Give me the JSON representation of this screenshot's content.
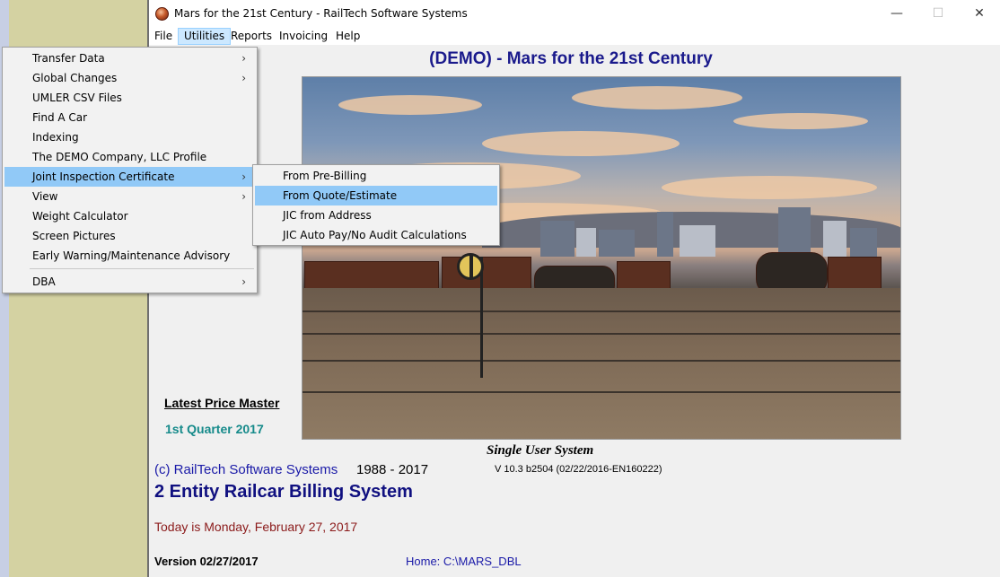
{
  "window": {
    "title": "Mars for the 21st Century - RailTech Software Systems",
    "controls": {
      "minimize": "—",
      "maximize": "☐",
      "close": "✕"
    }
  },
  "menubar": {
    "items": [
      "File",
      "Utilities",
      "Reports",
      "Invoicing",
      "Help"
    ],
    "active": "Utilities"
  },
  "utilities_menu": {
    "items": [
      {
        "label": "Transfer Data",
        "submenu": true
      },
      {
        "label": "Global Changes",
        "submenu": true
      },
      {
        "label": "UMLER CSV Files",
        "submenu": false
      },
      {
        "label": "Find A Car",
        "submenu": false
      },
      {
        "label": "Indexing",
        "submenu": false
      },
      {
        "label": "The DEMO Company, LLC Profile",
        "submenu": false
      },
      {
        "label": "Joint Inspection Certificate",
        "submenu": true,
        "highlighted": true
      },
      {
        "label": "View",
        "submenu": true
      },
      {
        "label": "Weight Calculator",
        "submenu": false
      },
      {
        "label": "Screen Pictures",
        "submenu": false
      },
      {
        "label": "Early Warning/Maintenance Advisory",
        "submenu": false
      },
      {
        "label": "DBA",
        "submenu": true
      }
    ],
    "arrow": "›"
  },
  "jic_submenu": {
    "items": [
      {
        "label": "From Pre-Billing"
      },
      {
        "label": "From Quote/Estimate",
        "highlighted": true
      },
      {
        "label": "JIC from Address"
      },
      {
        "label": "JIC Auto Pay/No Audit Calculations"
      }
    ]
  },
  "main": {
    "demo_title": "(DEMO) - Mars for the 21st Century",
    "latest_price_master": "Latest Price Master",
    "quarter": "1st Quarter 2017",
    "single_user": "Single User System",
    "copyright": "(c) RailTech Software Systems",
    "years": "1988 - 2017",
    "version_build": "V 10.3  b2504 (02/22/2016-EN160222)",
    "system_name": "2 Entity Railcar Billing System",
    "today": "Today is Monday, February 27, 2017",
    "version_date": "Version 02/27/2017",
    "home": "Home: C:\\MARS_DBL"
  },
  "colors": {
    "title_blue": "#1a1a8c",
    "quarter_teal": "#158a8a",
    "today_red": "#8b1a1a",
    "menu_highlight": "#91c9f7"
  }
}
